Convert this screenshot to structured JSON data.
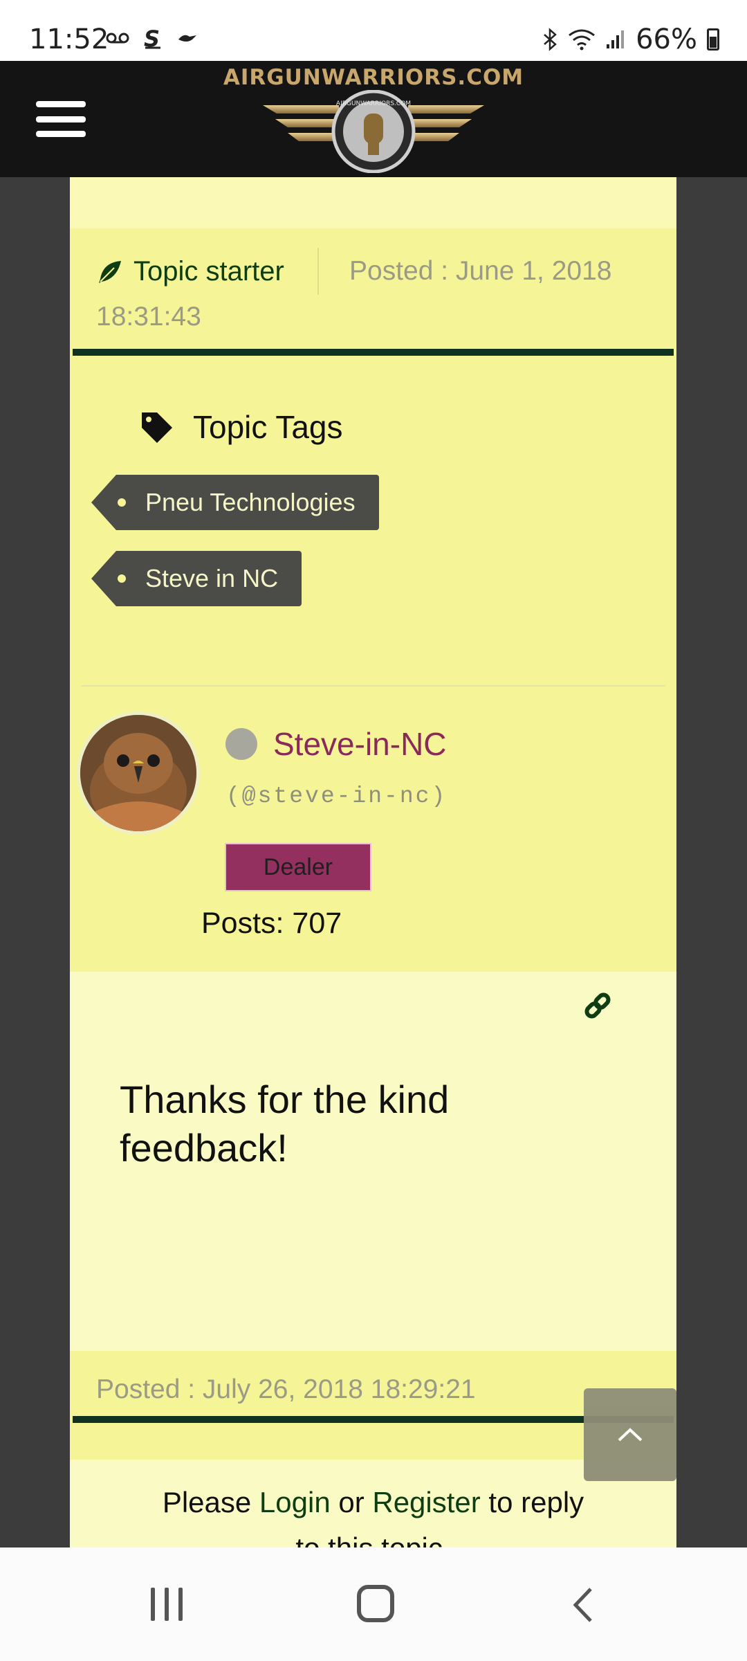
{
  "status_bar": {
    "time": "11:52",
    "battery": "66%",
    "left_icons": [
      "voicemail-icon",
      "s-app-icon",
      "raven-app-icon"
    ],
    "right_icons": [
      "bluetooth-icon",
      "wifi-icon",
      "signal-icon",
      "battery-icon"
    ]
  },
  "header": {
    "logo_text": "AIRGUNWARRIORS.COM",
    "emblem_text": "AIRGUNWARRIORS.COM",
    "menu_icon": "hamburger-menu-icon"
  },
  "post_meta": {
    "topic_starter": "Topic starter",
    "posted_line1": "Posted : June 1, 2018",
    "posted_line2": "18:31:43"
  },
  "topic_tags": {
    "title": "Topic Tags",
    "tags": [
      "Pneu Technologies",
      "Steve in NC"
    ]
  },
  "author": {
    "username": "Steve-in-NC",
    "handle": "(@steve-in-nc)",
    "badge": "Dealer",
    "posts": "Posts: 707",
    "status": "offline"
  },
  "post": {
    "text": "Thanks for the kind feedback!",
    "posted": "Posted : July 26, 2018 18:29:21"
  },
  "reply_prompt": {
    "prefix": "Please ",
    "login": "Login",
    "middle": " or ",
    "register": "Register",
    "suffix": " to reply",
    "line2": "to this topic."
  },
  "colors": {
    "content_bg": "#f5f598",
    "pale_bg": "#fafac5",
    "accent_green": "#0f3d12",
    "username": "#8a2a5a",
    "badge": "#93305f",
    "tag_bg": "#4b4b47"
  }
}
